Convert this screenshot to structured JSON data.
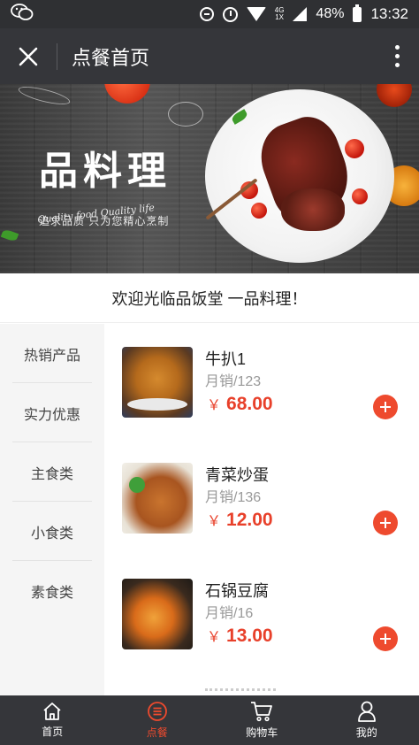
{
  "status_bar": {
    "net_top": "4G",
    "net_bottom": "1X",
    "battery": "48%",
    "time": "13:32"
  },
  "header": {
    "title": "点餐首页"
  },
  "banner": {
    "slogan_en": "Quality food Quality life",
    "brand": "品料理",
    "slogan_cn": "追求品质 只为您精心烹制"
  },
  "welcome": "欢迎光临品饭堂 一品料理！",
  "categories": [
    {
      "label": "热销产品"
    },
    {
      "label": "实力优惠"
    },
    {
      "label": "主食类"
    },
    {
      "label": "小食类"
    },
    {
      "label": "素食类"
    }
  ],
  "currency": "￥",
  "products": [
    {
      "name": "牛扒1",
      "sales": "月销/123",
      "price": "68.00"
    },
    {
      "name": "青菜炒蛋",
      "sales": "月销/136",
      "price": "12.00"
    },
    {
      "name": "石锅豆腐",
      "sales": "月销/16",
      "price": "13.00"
    }
  ],
  "tabbar": [
    {
      "label": "首页",
      "icon": "home-icon"
    },
    {
      "label": "点餐",
      "icon": "menu-icon",
      "active": true
    },
    {
      "label": "购物车",
      "icon": "cart-icon"
    },
    {
      "label": "我的",
      "icon": "user-icon"
    }
  ],
  "colors": {
    "accent": "#ee4a2e",
    "price": "#e8402a",
    "header_bg": "#35363a"
  }
}
